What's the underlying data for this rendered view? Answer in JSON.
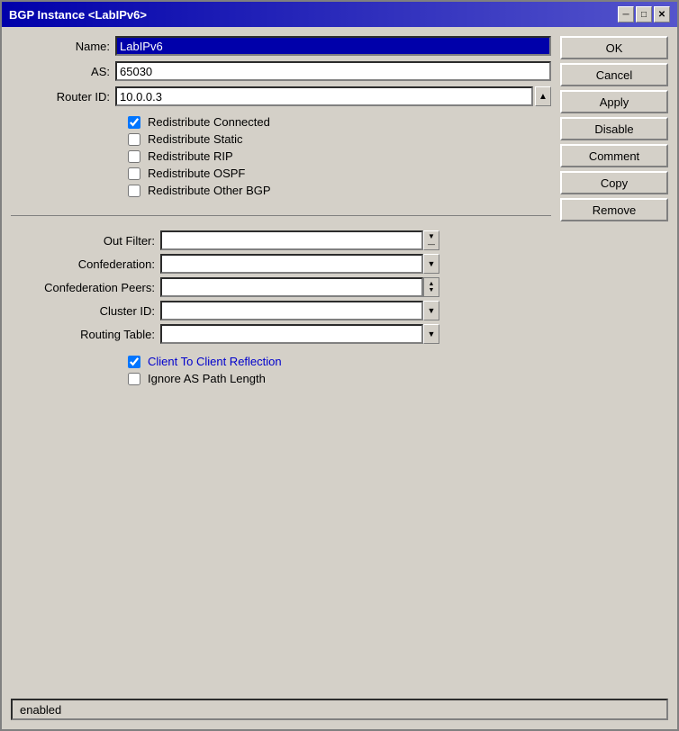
{
  "window": {
    "title": "BGP Instance <LabIPv6>",
    "minimize_label": "─",
    "maximize_label": "□",
    "close_label": "✕"
  },
  "form": {
    "name_label": "Name:",
    "name_value": "LabIPv6",
    "as_label": "AS:",
    "as_value": "65030",
    "router_id_label": "Router ID:",
    "router_id_value": "10.0.0.3",
    "checkboxes": [
      {
        "id": "chk1",
        "label": "Redistribute Connected",
        "checked": true
      },
      {
        "id": "chk2",
        "label": "Redistribute Static",
        "checked": false
      },
      {
        "id": "chk3",
        "label": "Redistribute RIP",
        "checked": false
      },
      {
        "id": "chk4",
        "label": "Redistribute OSPF",
        "checked": false
      },
      {
        "id": "chk5",
        "label": "Redistribute Other BGP",
        "checked": false
      }
    ],
    "dropdowns": [
      {
        "label": "Out Filter:",
        "value": "",
        "type": "filter"
      },
      {
        "label": "Confederation:",
        "value": "",
        "type": "simple"
      },
      {
        "label": "Confederation Peers:",
        "value": "",
        "type": "spin"
      },
      {
        "label": "Cluster ID:",
        "value": "",
        "type": "simple"
      },
      {
        "label": "Routing Table:",
        "value": "",
        "type": "simple"
      }
    ],
    "bottom_checkboxes": [
      {
        "id": "bchk1",
        "label": "Client To Client Reflection",
        "checked": true
      },
      {
        "id": "bchk2",
        "label": "Ignore AS Path Length",
        "checked": false
      }
    ]
  },
  "buttons": {
    "ok": "OK",
    "cancel": "Cancel",
    "apply": "Apply",
    "disable": "Disable",
    "comment": "Comment",
    "copy": "Copy",
    "remove": "Remove"
  },
  "status": {
    "text": "enabled"
  }
}
